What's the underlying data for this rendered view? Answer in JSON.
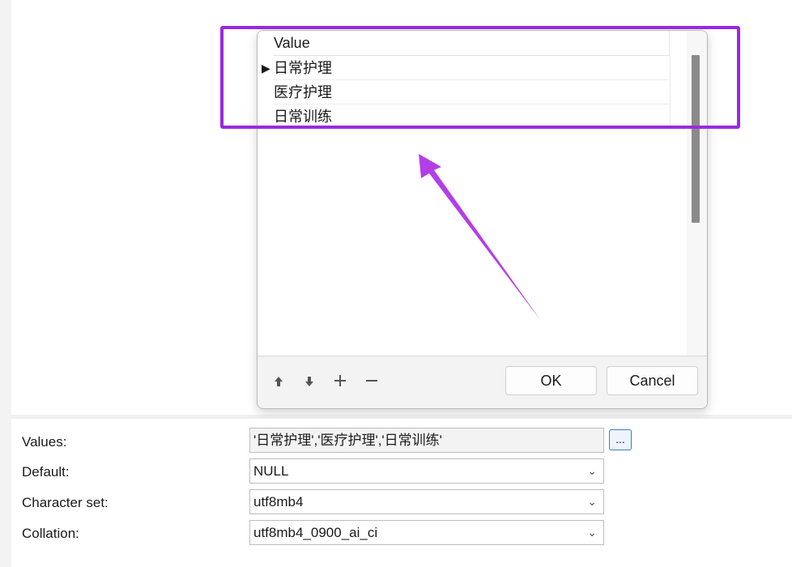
{
  "dialog": {
    "grid": {
      "column_header": "Value",
      "rows": [
        {
          "indicator": "▶",
          "value": "日常护理"
        },
        {
          "indicator": "",
          "value": "医疗护理"
        },
        {
          "indicator": "",
          "value": "日常训练"
        }
      ]
    },
    "toolbar": {
      "move_up_icon": "arrow-up-icon",
      "move_down_icon": "arrow-down-icon",
      "add_icon": "plus-icon",
      "remove_icon": "minus-icon",
      "move_up_glyph": "🠉",
      "move_down_glyph": "🠋",
      "add_glyph": "+",
      "remove_glyph": "—"
    },
    "ok_label": "OK",
    "cancel_label": "Cancel"
  },
  "properties": {
    "values": {
      "label": "Values:",
      "value": "'日常护理','医疗护理','日常训练'",
      "button_label": "..."
    },
    "default": {
      "label": "Default:",
      "value": "NULL"
    },
    "charset": {
      "label": "Character set:",
      "value": "utf8mb4"
    },
    "collation": {
      "label": "Collation:",
      "value": "utf8mb4_0900_ai_ci"
    }
  },
  "annotation": {
    "color": "#9b28e0",
    "arrow_color": "#b43ee6"
  }
}
